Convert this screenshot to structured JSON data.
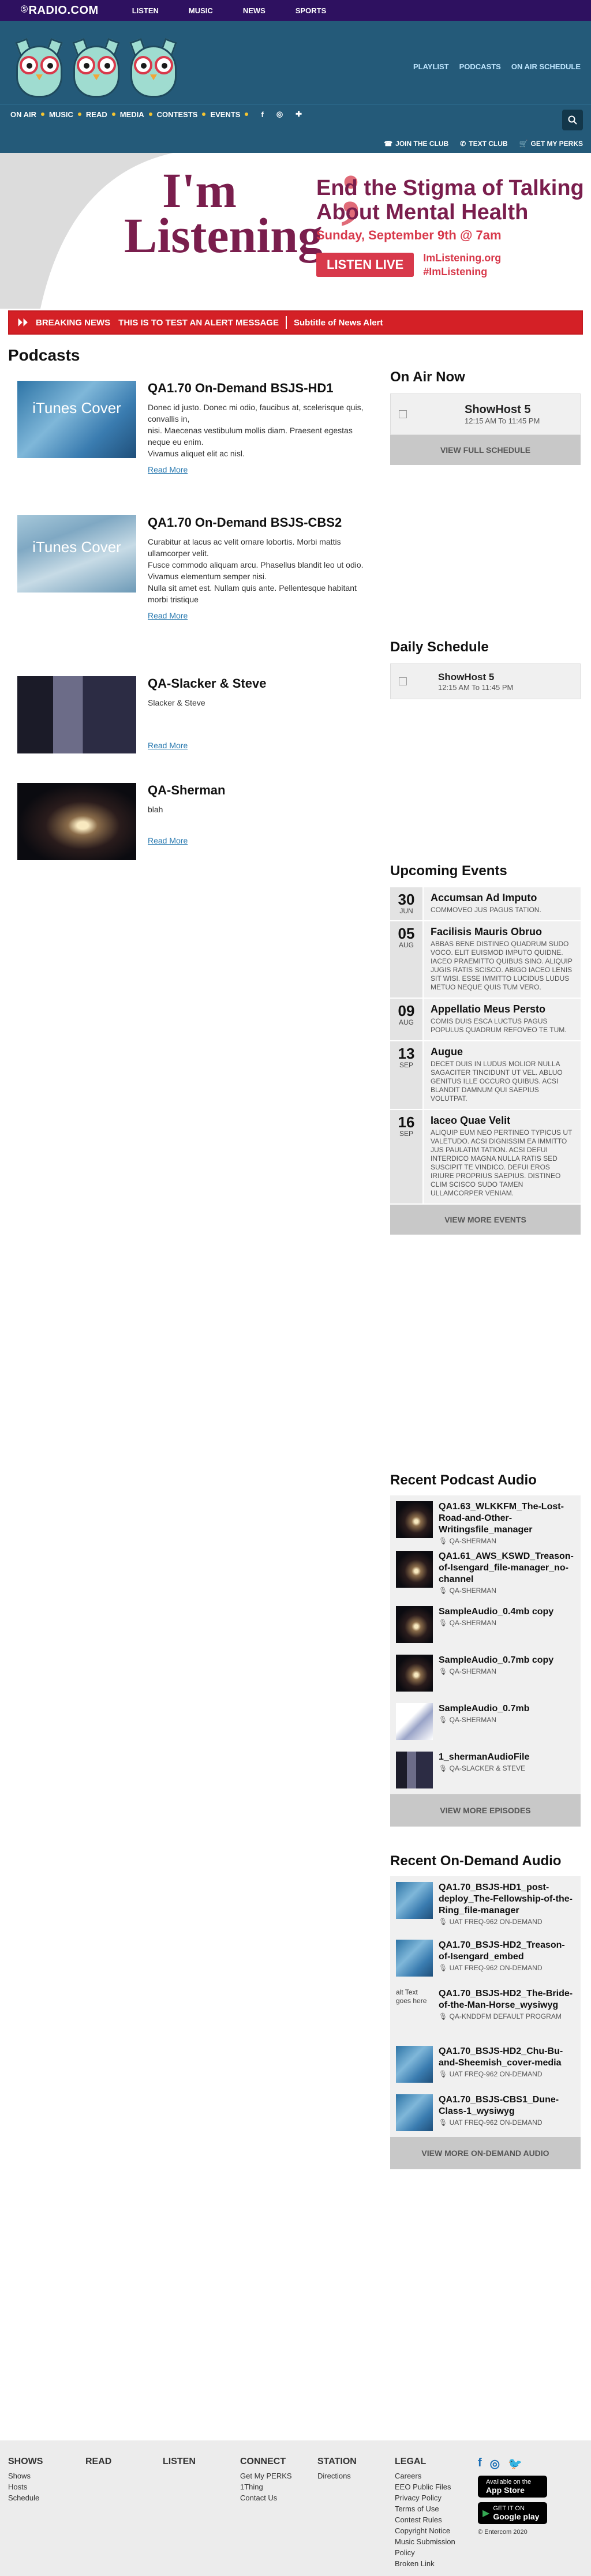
{
  "topbar": {
    "logo_prefix": "Ⓢ",
    "logo": "RADIO.COM",
    "nav": [
      "LISTEN",
      "MUSIC",
      "NEWS",
      "SPORTS"
    ]
  },
  "header": {
    "links": [
      "PLAYLIST",
      "PODCASTS",
      "ON AIR SCHEDULE"
    ]
  },
  "navbar": {
    "items": [
      "ON AIR",
      "MUSIC",
      "READ",
      "MEDIA",
      "CONTESTS",
      "EVENTS"
    ],
    "social": [
      "f",
      "◎",
      "✚"
    ],
    "actions": [
      {
        "icon": "☎",
        "label": "JOIN THE CLUB"
      },
      {
        "icon": "✆",
        "label": "TEXT CLUB"
      },
      {
        "icon": "🛒",
        "label": "GET MY PERKS"
      }
    ]
  },
  "banner": {
    "im": "I'm",
    "listening": "Listening",
    "semi": ";",
    "line1": "End the Stigma of Talking",
    "line2": "About Mental Health",
    "date": "Sunday, September 9th @ 7am",
    "cta": "LISTEN LIVE",
    "site1": "ImListening.org",
    "site2": "#ImListening"
  },
  "alert": {
    "label": "BREAKING NEWS",
    "message": "THIS IS TO TEST AN ALERT MESSAGE",
    "subtitle": "Subtitle of News Alert"
  },
  "podcasts": {
    "heading": "Podcasts",
    "read_more": "Read More",
    "items": [
      {
        "title": "QA1.70 On-Demand BSJS-HD1",
        "thumb_text": "iTunes Cover",
        "desc": [
          "Donec id justo. Donec mi odio, faucibus at, scelerisque quis, convallis in,",
          "nisi. Maecenas vestibulum mollis diam. Praesent egestas neque eu enim.",
          "Vivamus aliquet elit ac nisl."
        ]
      },
      {
        "title": "QA1.70 On-Demand BSJS-CBS2",
        "thumb_text": "iTunes Cover",
        "desc": [
          "Curabitur at lacus ac velit ornare lobortis. Morbi mattis ullamcorper velit.",
          "Fusce commodo aliquam arcu. Phasellus blandit leo ut odio. Vivamus elementum semper nisi.",
          "Nulla sit amet est. Nullam quis ante. Pellentesque habitant morbi tristique"
        ]
      },
      {
        "title": "QA-Slacker & Steve",
        "thumb_text": "",
        "desc": [
          "Slacker & Steve"
        ]
      },
      {
        "title": "QA-Sherman",
        "thumb_text": "",
        "desc": [
          "blah"
        ]
      }
    ]
  },
  "on_air": {
    "heading": "On Air Now",
    "show": "ShowHost 5",
    "time": "12:15 AM To 11:45 PM",
    "button": "VIEW FULL SCHEDULE"
  },
  "daily": {
    "heading": "Daily Schedule",
    "show": "ShowHost 5",
    "time": "12:15 AM To 11:45 PM"
  },
  "events": {
    "heading": "Upcoming Events",
    "button": "VIEW MORE EVENTS",
    "items": [
      {
        "day": "30",
        "month": "JUN",
        "title": "Accumsan Ad Imputo",
        "desc": "COMMOVEO JUS PAGUS TATION."
      },
      {
        "day": "05",
        "month": "AUG",
        "title": "Facilisis Mauris Obruo",
        "desc": "ABBAS BENE DISTINEO QUADRUM SUDO VOCO. ELIT EUISMOD IMPUTO QUIDNE. IACEO PRAEMITTO QUIBUS SINO. ALIQUIP JUGIS RATIS SCISCO. ABIGO IACEO LENIS SIT WISI. ESSE IMMITTO LUCIDUS LUDUS METUO NEQUE QUIS TUM VERO."
      },
      {
        "day": "09",
        "month": "AUG",
        "title": "Appellatio Meus Persto",
        "desc": "COMIS DUIS ESCA LUCTUS PAGUS POPULUS QUADRUM REFOVEO TE TUM."
      },
      {
        "day": "13",
        "month": "SEP",
        "title": "Augue",
        "desc": "DECET DUIS IN LUDUS MOLIOR NULLA SAGACITER TINCIDUNT UT VEL. ABLUO GENITUS ILLE OCCURO QUIBUS. ACSI BLANDIT DAMNUM QUI SAEPIUS VOLUTPAT."
      },
      {
        "day": "16",
        "month": "SEP",
        "title": "Iaceo Quae Velit",
        "desc": "ALIQUIP EUM NEO PERTINEO TYPICUS UT VALETUDO. ACSI DIGNISSIM EA IMMITTO JUS PAULATIM TATION. ACSI DEFUI INTERDICO MAGNA NULLA RATIS SED SUSCIPIT TE VINDICO. DEFUI EROS IRIURE PROPRIUS SAEPIUS. DISTINEO CLIM SCISCO SUDO TAMEN ULLAMCORPER VENIAM."
      }
    ]
  },
  "recent_podcast_audio": {
    "heading": "Recent Podcast Audio",
    "button": "VIEW MORE EPISODES",
    "items": [
      {
        "title": "QA1.63_WLKKFM_The-Lost-Road-and-Other-Writingsfile_manager",
        "sub": "QA-SHERMAN",
        "thumb": "galaxy"
      },
      {
        "title": "QA1.61_AWS_KSWD_Treason-of-Isengard_file-manager_no-channel",
        "sub": "QA-SHERMAN",
        "thumb": "galaxy"
      },
      {
        "title": "SampleAudio_0.4mb copy",
        "sub": "QA-SHERMAN",
        "thumb": "galaxy"
      },
      {
        "title": "SampleAudio_0.7mb copy",
        "sub": "QA-SHERMAN",
        "thumb": "galaxy"
      },
      {
        "title": "SampleAudio_0.7mb",
        "sub": "QA-SHERMAN",
        "thumb": "cartoon"
      },
      {
        "title": "1_shermanAudioFile",
        "sub": "QA-SLACKER & STEVE",
        "thumb": "guy"
      }
    ]
  },
  "recent_ondemand": {
    "heading": "Recent On-Demand Audio",
    "button": "VIEW MORE ON-DEMAND AUDIO",
    "items": [
      {
        "title": "QA1.70_BSJS-HD1_post-deploy_The-Fellowship-of-the-Ring_file-manager",
        "sub": "UAT FREQ-962 ON-DEMAND",
        "thumb": "itunes"
      },
      {
        "title": "QA1.70_BSJS-HD2_Treason-of-Isengard_embed",
        "sub": "UAT FREQ-962 ON-DEMAND",
        "thumb": "itunes"
      },
      {
        "title": "QA1.70_BSJS-HD2_The-Bride-of-the-Man-Horse_wysiwyg",
        "sub": "QA-KNDDFM DEFAULT PROGRAM",
        "thumb": "alt",
        "alt": "alt Text goes here"
      },
      {
        "title": "QA1.70_BSJS-HD2_Chu-Bu-and-Sheemish_cover-media",
        "sub": "UAT FREQ-962 ON-DEMAND",
        "thumb": "itunes"
      },
      {
        "title": "QA1.70_BSJS-CBS1_Dune-Class-1_wysiwyg",
        "sub": "UAT FREQ-962 ON-DEMAND",
        "thumb": "itunes"
      }
    ]
  },
  "footer": {
    "cols": [
      {
        "h": "SHOWS",
        "links": [
          "Shows",
          "Hosts",
          "Schedule"
        ]
      },
      {
        "h": "READ",
        "links": []
      },
      {
        "h": "LISTEN",
        "links": []
      },
      {
        "h": "CONNECT",
        "links": [
          "Get My PERKS",
          "1Thing",
          "Contact Us"
        ]
      },
      {
        "h": "STATION",
        "links": [
          "Directions"
        ]
      },
      {
        "h": "LEGAL",
        "links": [
          "Careers",
          "EEO Public Files",
          "Privacy Policy",
          "Terms of Use",
          "Contest Rules",
          "Copyright Notice",
          "Music Submission Policy",
          "Broken Link"
        ]
      }
    ],
    "social": [
      "f",
      "◎",
      "🐦"
    ],
    "app_store": {
      "small": "Available on the",
      "big": "App Store"
    },
    "google_play": {
      "small": "GET IT ON",
      "big": "Google play"
    },
    "copyright": "© Entercom 2020"
  }
}
